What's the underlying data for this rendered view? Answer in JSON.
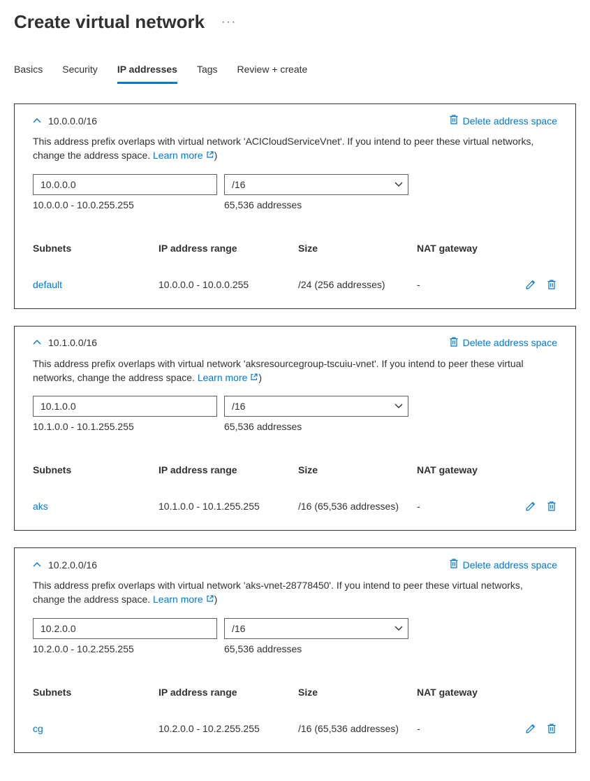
{
  "page": {
    "title": "Create virtual network"
  },
  "tabs": [
    {
      "label": "Basics",
      "selected": false
    },
    {
      "label": "Security",
      "selected": false
    },
    {
      "label": "IP addresses",
      "selected": true
    },
    {
      "label": "Tags",
      "selected": false
    },
    {
      "label": "Review + create",
      "selected": false
    }
  ],
  "common": {
    "delete_label": "Delete address space",
    "learn_more_label": "Learn more",
    "paren_close": ")",
    "headers": {
      "subnets": "Subnets",
      "range": "IP address range",
      "size": "Size",
      "nat": "NAT gateway"
    }
  },
  "spaces": [
    {
      "cidr": "10.0.0.0/16",
      "overlap_text": "This address prefix overlaps with virtual network 'ACICloudServiceVnet'. If you intend to peer these virtual networks, change the address space.  ",
      "ip_value": "10.0.0.0",
      "mask_value": "/16",
      "range_text": "10.0.0.0 - 10.0.255.255",
      "count_text": "65,536 addresses",
      "subnets": [
        {
          "name": "default",
          "range": "10.0.0.0 - 10.0.0.255",
          "size": "/24 (256 addresses)",
          "nat": "-"
        }
      ]
    },
    {
      "cidr": "10.1.0.0/16",
      "overlap_text": "This address prefix overlaps with virtual network 'aksresourcegroup-tscuiu-vnet'. If you intend to peer these virtual networks, change the address space.  ",
      "ip_value": "10.1.0.0",
      "mask_value": "/16",
      "range_text": "10.1.0.0 - 10.1.255.255",
      "count_text": "65,536 addresses",
      "subnets": [
        {
          "name": "aks",
          "range": "10.1.0.0 - 10.1.255.255",
          "size": "/16 (65,536 addresses)",
          "nat": "-"
        }
      ]
    },
    {
      "cidr": "10.2.0.0/16",
      "overlap_text": "This address prefix overlaps with virtual network 'aks-vnet-28778450'. If you intend to peer these virtual networks, change the address space.  ",
      "ip_value": "10.2.0.0",
      "mask_value": "/16",
      "range_text": "10.2.0.0 - 10.2.255.255",
      "count_text": "65,536 addresses",
      "subnets": [
        {
          "name": "cg",
          "range": "10.2.0.0 - 10.2.255.255",
          "size": "/16 (65,536 addresses)",
          "nat": "-"
        }
      ]
    }
  ]
}
